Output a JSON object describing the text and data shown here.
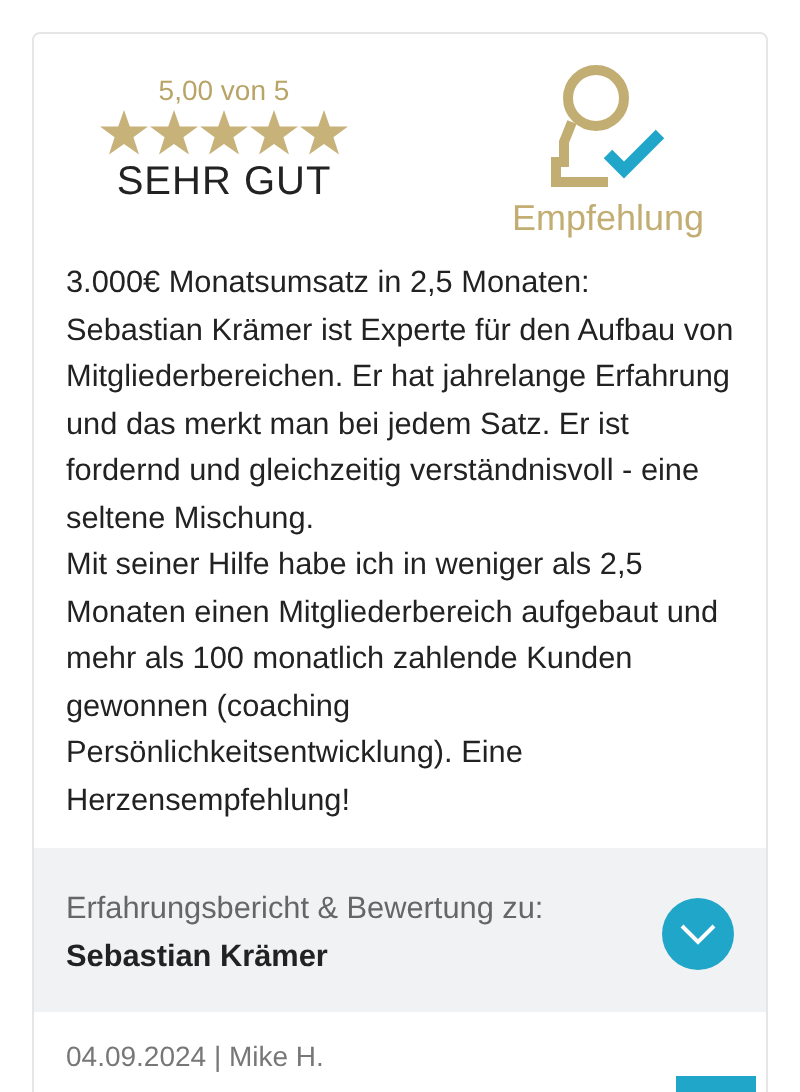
{
  "rating": {
    "score": "5,00 von 5",
    "stars": 5,
    "verdict": "SEHR GUT"
  },
  "badge": {
    "label": "Empfehlung"
  },
  "review": [
    "3.000€ Monatsumsatz in 2,5 Monaten:",
    "Sebastian Krämer ist Experte für den Aufbau von Mitgliederbereichen. Er hat jahrelange Erfahrung und das merkt man bei jedem Satz. Er ist fordernd und gleichzeitig verständnisvoll - eine seltene Mischung.",
    "Mit seiner Hilfe habe ich in weniger als 2,5 Monaten einen Mitgliederbereich aufgebaut und mehr als 100 monatlich zahlende Kunden gewonnen (coaching Persönlichkeitsentwicklung). Eine Herzensempfehlung!"
  ],
  "subject": {
    "caption": "Erfahrungsbericht & Bewertung zu:",
    "name": "Sebastian Krämer",
    "expanded": false
  },
  "footer": "04.09.2024 | Mike H."
}
